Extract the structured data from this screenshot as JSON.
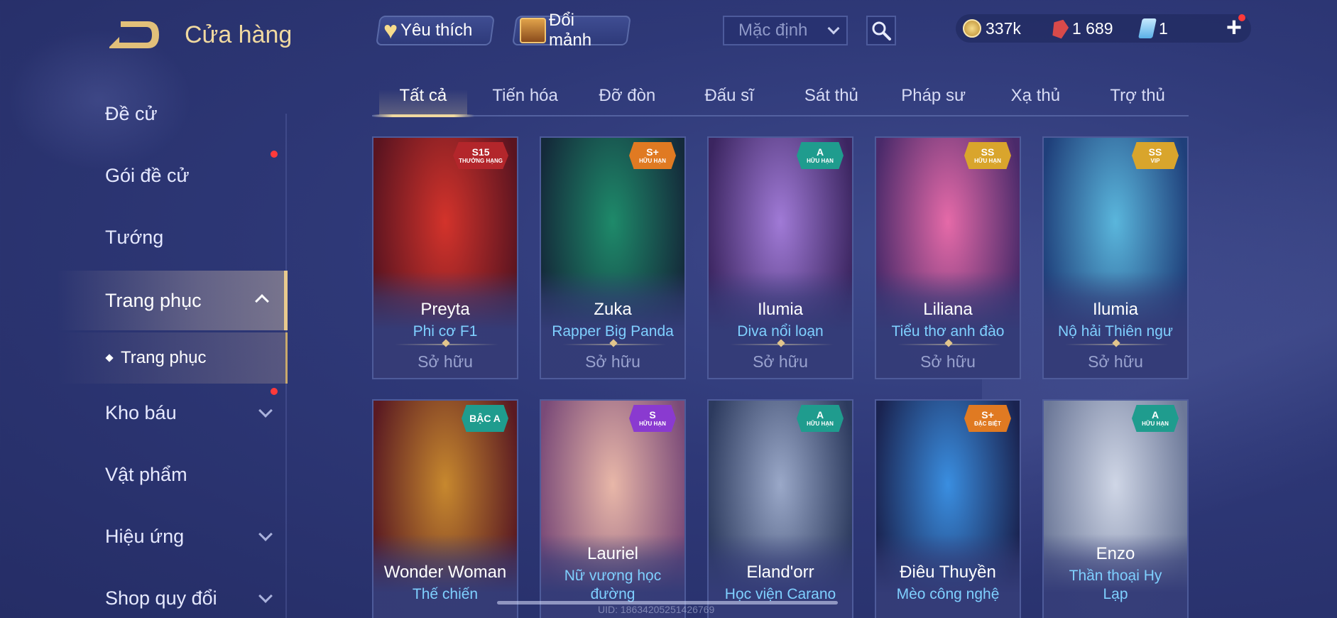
{
  "header": {
    "title": "Cửa hàng",
    "favorites_label": "Yêu thích",
    "exchange_label": "Đổi mảnh",
    "sort_value": "Mặc định"
  },
  "currency": {
    "gold": "337k",
    "gems": "1 689",
    "cards": "1"
  },
  "sidebar": {
    "items": [
      {
        "label": "Đề cử"
      },
      {
        "label": "Gói đề cử"
      },
      {
        "label": "Tướng"
      },
      {
        "label": "Trang phục"
      },
      {
        "label": "Kho báu"
      },
      {
        "label": "Vật phẩm"
      },
      {
        "label": "Hiệu ứng"
      },
      {
        "label": "Shop quy đổi"
      }
    ],
    "sub_label": "Trang phục"
  },
  "tabs": [
    "Tất cả",
    "Tiến hóa",
    "Đỡ đòn",
    "Đấu sĩ",
    "Sát thủ",
    "Pháp sư",
    "Xạ thủ",
    "Trợ thủ"
  ],
  "skins": [
    {
      "hero": "Preyta",
      "skin": "Phi cơ F1",
      "status": "Sở hữu",
      "badge": "S15",
      "badge_sub": "THƯỞNG HẠNG",
      "colors": [
        "#d3332b",
        "#5a1420"
      ]
    },
    {
      "hero": "Zuka",
      "skin": "Rapper Big Panda",
      "status": "Sở hữu",
      "badge": "S+",
      "badge_sub": "HỮU HẠN",
      "colors": [
        "#1e8a6a",
        "#142a3a"
      ]
    },
    {
      "hero": "Ilumia",
      "skin": "Diva nổi loạn",
      "status": "Sở hữu",
      "badge": "A",
      "badge_sub": "HỮU HẠN",
      "colors": [
        "#a07ad6",
        "#3b2560"
      ]
    },
    {
      "hero": "Liliana",
      "skin": "Tiểu thơ anh đào",
      "status": "Sở hữu",
      "badge": "SS",
      "badge_sub": "HỮU HẠN",
      "colors": [
        "#e56aa8",
        "#4a2a6a"
      ]
    },
    {
      "hero": "Ilumia",
      "skin": "Nộ hải Thiên ngư",
      "status": "Sở hữu",
      "badge": "SS",
      "badge_sub": "VIP",
      "colors": [
        "#5ab6dc",
        "#1f3f7a"
      ]
    },
    {
      "hero": "Wonder Woman",
      "skin": "Thế chiến",
      "status": "",
      "badge": "BẬC A",
      "badge_sub": "",
      "colors": [
        "#c7882e",
        "#5a1a22"
      ]
    },
    {
      "hero": "Lauriel",
      "skin": "Nữ vương học đường",
      "status": "",
      "badge": "S",
      "badge_sub": "HỮU HẠN",
      "colors": [
        "#e8b7a8",
        "#7a4a78"
      ]
    },
    {
      "hero": "Eland'orr",
      "skin": "Học viện Carano",
      "status": "",
      "badge": "A",
      "badge_sub": "HỮU HẠN",
      "colors": [
        "#9aa8c8",
        "#2c3a5e"
      ]
    },
    {
      "hero": "Điêu Thuyền",
      "skin": "Mèo công nghệ",
      "status": "",
      "badge": "S+",
      "badge_sub": "ĐẶC BIỆT",
      "colors": [
        "#3a8ee0",
        "#1a2350"
      ]
    },
    {
      "hero": "Enzo",
      "skin": "Thần thoại Hy Lạp",
      "status": "",
      "badge": "A",
      "badge_sub": "HỮU HẠN",
      "colors": [
        "#cfd6e6",
        "#6c7898"
      ]
    }
  ],
  "footer": {
    "uid_text": "UID: 18634205251426769"
  },
  "colors": {
    "accent_gold": "#f0d9a0",
    "skin_name_blue": "#7fd0ff",
    "notification_red": "#ff3a3a"
  }
}
